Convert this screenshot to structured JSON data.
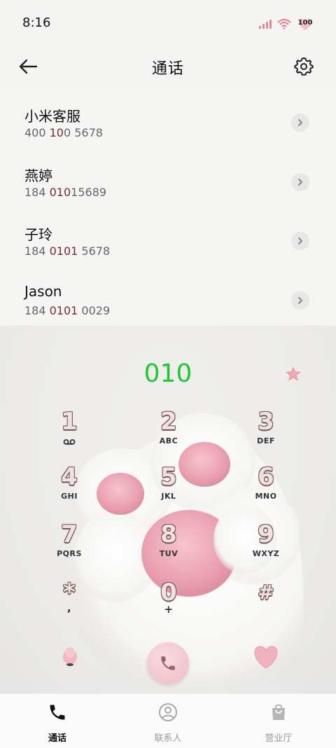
{
  "status": {
    "time": "8:16",
    "battery": "100"
  },
  "header": {
    "title": "通话"
  },
  "calls": [
    {
      "name": "小米客服",
      "num_pre": "400 ",
      "num_hl": "10",
      "num_post": "0 5678"
    },
    {
      "name": "燕婷",
      "num_pre": "184 ",
      "num_hl": "010",
      "num_post": "15689"
    },
    {
      "name": "子玲",
      "num_pre": "184 ",
      "num_hl": "0101",
      "num_post": " 5678"
    },
    {
      "name": "Jason",
      "num_pre": "184 ",
      "num_hl": "0101",
      "num_post": " 0029"
    }
  ],
  "dialer": {
    "input": "010",
    "keys": [
      {
        "digit": "1",
        "letters": ""
      },
      {
        "digit": "2",
        "letters": "ABC"
      },
      {
        "digit": "3",
        "letters": "DEF"
      },
      {
        "digit": "4",
        "letters": "GHI"
      },
      {
        "digit": "5",
        "letters": "JKL"
      },
      {
        "digit": "6",
        "letters": "MNO"
      },
      {
        "digit": "7",
        "letters": "PQRS"
      },
      {
        "digit": "8",
        "letters": "TUV"
      },
      {
        "digit": "9",
        "letters": "WXYZ"
      },
      {
        "digit": "*",
        "letters": ","
      },
      {
        "digit": "0",
        "letters": "+"
      },
      {
        "digit": "#",
        "letters": ""
      }
    ]
  },
  "tabs": [
    {
      "label": "通话",
      "icon": "phone-icon",
      "active": true
    },
    {
      "label": "联系人",
      "icon": "contact-icon",
      "active": false
    },
    {
      "label": "营业厅",
      "icon": "store-bag-icon",
      "active": false
    }
  ],
  "colors": {
    "accent_green": "#22c633",
    "highlight": "#7a2a36",
    "pink": "#f0bcc6"
  }
}
